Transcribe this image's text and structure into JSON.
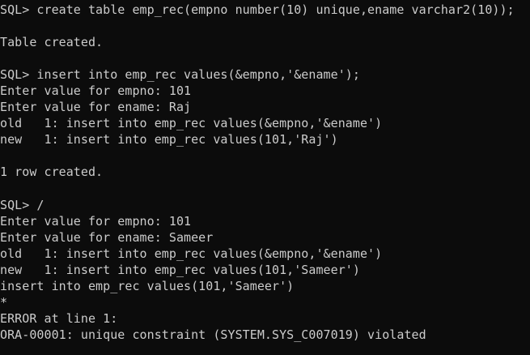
{
  "terminal": {
    "lines": [
      "SQL> create table emp_rec(empno number(10) unique,ename varchar2(10));",
      "",
      "Table created.",
      "",
      "SQL> insert into emp_rec values(&empno,'&ename');",
      "Enter value for empno: 101",
      "Enter value for ename: Raj",
      "old   1: insert into emp_rec values(&empno,'&ename')",
      "new   1: insert into emp_rec values(101,'Raj')",
      "",
      "1 row created.",
      "",
      "SQL> /",
      "Enter value for empno: 101",
      "Enter value for ename: Sameer",
      "old   1: insert into emp_rec values(&empno,'&ename')",
      "new   1: insert into emp_rec values(101,'Sameer')",
      "insert into emp_rec values(101,'Sameer')",
      "*",
      "ERROR at line 1:",
      "ORA-00001: unique constraint (SYSTEM.SYS_C007019) violated"
    ]
  }
}
